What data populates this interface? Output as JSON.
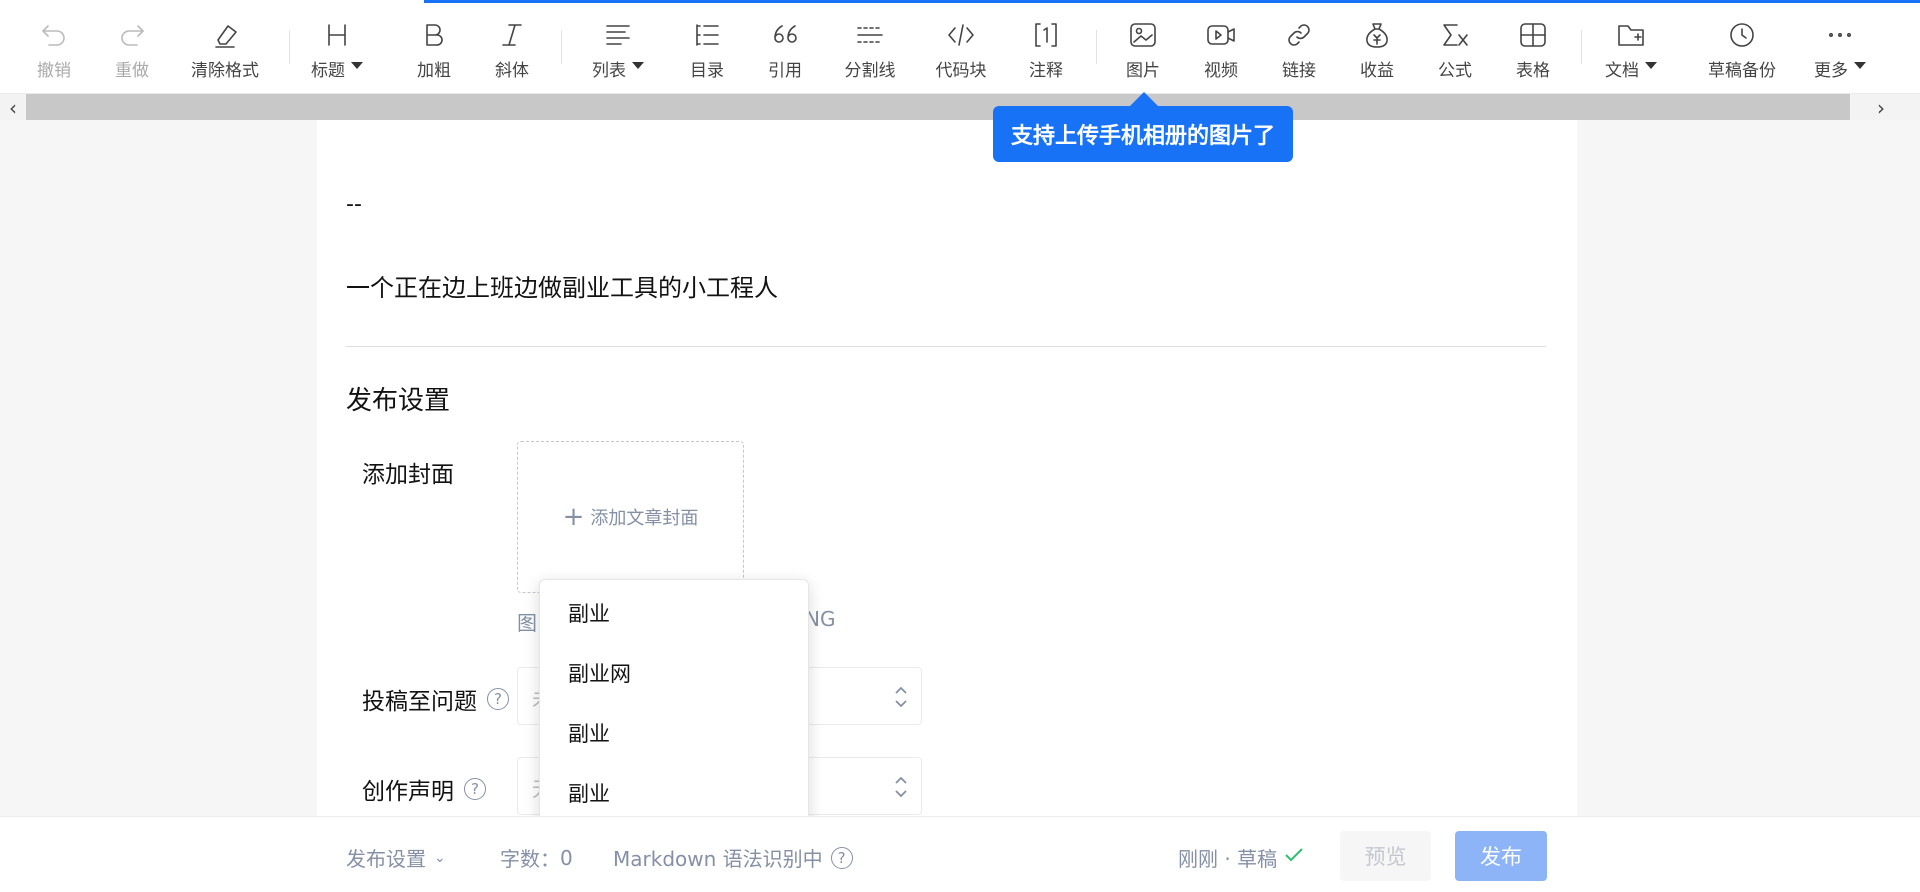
{
  "toolbar": {
    "items": [
      {
        "label": "撤销",
        "icon": "undo-icon"
      },
      {
        "label": "重做",
        "icon": "redo-icon"
      },
      {
        "label": "清除格式",
        "icon": "eraser-icon"
      },
      {
        "label": "标题",
        "icon": "heading-icon"
      },
      {
        "label": "加粗",
        "icon": "bold-icon"
      },
      {
        "label": "斜体",
        "icon": "italic-icon"
      },
      {
        "label": "列表",
        "icon": "list-icon"
      },
      {
        "label": "目录",
        "icon": "toc-icon"
      },
      {
        "label": "引用",
        "icon": "quote-icon"
      },
      {
        "label": "分割线",
        "icon": "divider-icon"
      },
      {
        "label": "代码块",
        "icon": "code-icon"
      },
      {
        "label": "注释",
        "icon": "footnote-icon"
      },
      {
        "label": "图片",
        "icon": "image-icon"
      },
      {
        "label": "视频",
        "icon": "video-icon"
      },
      {
        "label": "链接",
        "icon": "link-icon"
      },
      {
        "label": "收益",
        "icon": "money-bag-icon"
      },
      {
        "label": "公式",
        "icon": "formula-icon"
      },
      {
        "label": "表格",
        "icon": "table-icon"
      },
      {
        "label": "文档",
        "icon": "folder-add-icon"
      },
      {
        "label": "草稿备份",
        "icon": "clock-icon"
      },
      {
        "label": "更多",
        "icon": "more-icon"
      }
    ]
  },
  "tooltip": {
    "text": "支持上传手机相册的图片了"
  },
  "editor": {
    "dashes": "--",
    "bio": "一个正在边上班边做副业工具的小工程人"
  },
  "publish_settings": {
    "title": "发布设置",
    "cover_label": "添加封面",
    "cover_button": "添加文章封面",
    "cover_plus": "+",
    "hint_left": "图",
    "hint_right": "NG",
    "question_label": "投稿至问题",
    "question_value": "未",
    "declaration_label": "创作声明",
    "declaration_value": "无"
  },
  "dropdown": {
    "items": [
      "副业",
      "副业网",
      "副业",
      "副业"
    ]
  },
  "bottombar": {
    "settings_label": "发布设置",
    "word_count_label": "字数：",
    "word_count_value": "0",
    "markdown_label": "Markdown 语法识别中",
    "save_status": "刚刚 · 草稿",
    "preview_button": "预览",
    "publish_button": "发布"
  },
  "colors": {
    "accent": "#1772f6",
    "publish_disabled": "#8cb4f6",
    "muted": "#8590a6",
    "saved_check": "#2fbf71"
  }
}
